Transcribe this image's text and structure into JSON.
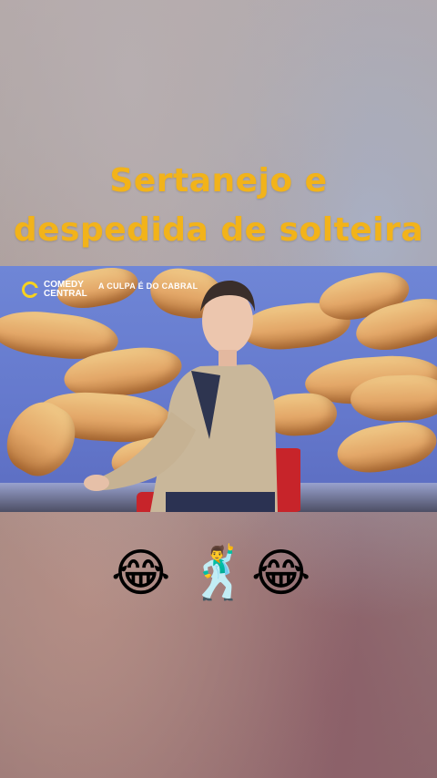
{
  "caption": {
    "line1": "Sertanejo e",
    "line2": "despedida de solteira"
  },
  "video": {
    "channel_logo": "COMEDY CENTRAL",
    "channel_line1": "COMEDY",
    "channel_line2": "CENTRAL",
    "show_title": "A CULPA É DO CABRAL"
  },
  "emojis": {
    "left": "😂",
    "middle": "🕺",
    "right": "😂",
    "left_name": "face-with-tears-of-joy-icon",
    "middle_name": "man-dancing-icon",
    "right_name": "face-with-tears-of-joy-icon"
  },
  "colors": {
    "caption": "#f2b31a",
    "logo_ring": "#f7d21e"
  }
}
